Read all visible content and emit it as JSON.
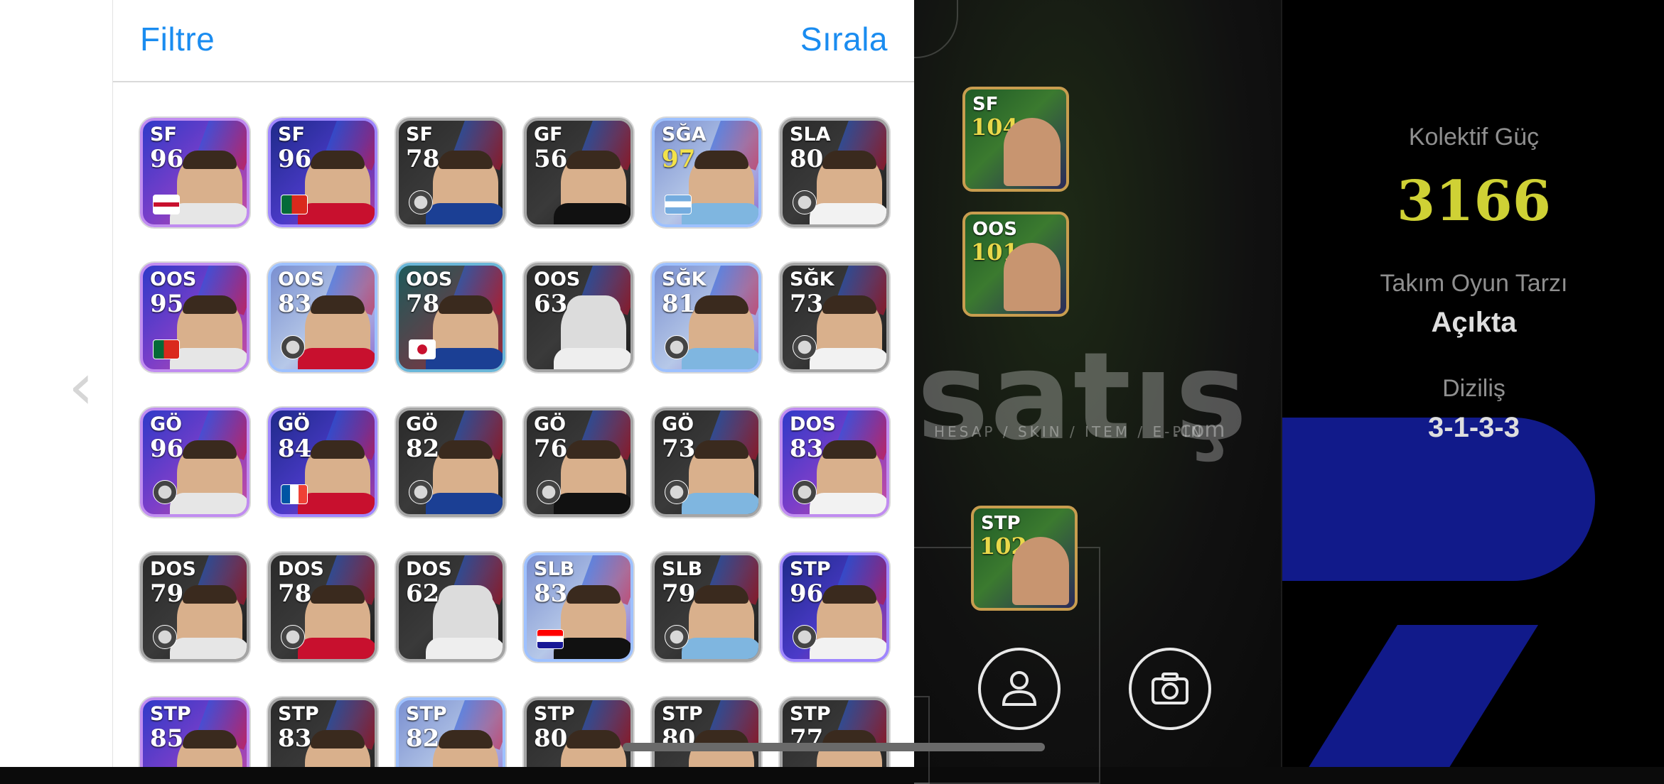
{
  "header": {
    "filter_label": "Filtre",
    "sort_label": "Sırala"
  },
  "back_chevron": "‹",
  "cards": [
    [
      {
        "pos": "SF",
        "ovr": "96",
        "rarity": "epic",
        "flag": "england"
      },
      {
        "pos": "SF",
        "ovr": "96",
        "rarity": "big",
        "flag": "portugal"
      },
      {
        "pos": "SF",
        "ovr": "78",
        "rarity": "std",
        "flag": "club"
      },
      {
        "pos": "GF",
        "ovr": "56",
        "rarity": "std",
        "flag": "none"
      },
      {
        "pos": "SĞA",
        "ovr": "97",
        "rarity": "show",
        "flag": "argentina",
        "gold": true
      },
      {
        "pos": "SLA",
        "ovr": "80",
        "rarity": "std",
        "flag": "club"
      }
    ],
    [
      {
        "pos": "OOS",
        "ovr": "95",
        "rarity": "epic",
        "flag": "portugal"
      },
      {
        "pos": "OOS",
        "ovr": "83",
        "rarity": "show",
        "flag": "club"
      },
      {
        "pos": "OOS",
        "ovr": "78",
        "rarity": "hl",
        "flag": "korea"
      },
      {
        "pos": "OOS",
        "ovr": "63",
        "rarity": "std",
        "flag": "none",
        "blank": true
      },
      {
        "pos": "SĞK",
        "ovr": "81",
        "rarity": "show",
        "flag": "club"
      },
      {
        "pos": "SĞK",
        "ovr": "73",
        "rarity": "std",
        "flag": "club"
      }
    ],
    [
      {
        "pos": "GÖ",
        "ovr": "96",
        "rarity": "epic",
        "flag": "club"
      },
      {
        "pos": "GÖ",
        "ovr": "84",
        "rarity": "big",
        "flag": "france"
      },
      {
        "pos": "GÖ",
        "ovr": "82",
        "rarity": "std",
        "flag": "club"
      },
      {
        "pos": "GÖ",
        "ovr": "76",
        "rarity": "std",
        "flag": "club"
      },
      {
        "pos": "GÖ",
        "ovr": "73",
        "rarity": "std",
        "flag": "club"
      },
      {
        "pos": "DOS",
        "ovr": "83",
        "rarity": "epic",
        "flag": "club"
      }
    ],
    [
      {
        "pos": "DOS",
        "ovr": "79",
        "rarity": "std",
        "flag": "club"
      },
      {
        "pos": "DOS",
        "ovr": "78",
        "rarity": "std",
        "flag": "club"
      },
      {
        "pos": "DOS",
        "ovr": "62",
        "rarity": "std",
        "flag": "none",
        "blank": true
      },
      {
        "pos": "SLB",
        "ovr": "83",
        "rarity": "show",
        "flag": "croatia"
      },
      {
        "pos": "SLB",
        "ovr": "79",
        "rarity": "std",
        "flag": "club"
      },
      {
        "pos": "STP",
        "ovr": "96",
        "rarity": "big",
        "flag": "club"
      }
    ],
    [
      {
        "pos": "STP",
        "ovr": "85",
        "rarity": "epic",
        "flag": "club"
      },
      {
        "pos": "STP",
        "ovr": "83",
        "rarity": "std",
        "flag": "club"
      },
      {
        "pos": "STP",
        "ovr": "82",
        "rarity": "show",
        "flag": "club"
      },
      {
        "pos": "STP",
        "ovr": "80",
        "rarity": "std",
        "flag": "club"
      },
      {
        "pos": "STP",
        "ovr": "80",
        "rarity": "std",
        "flag": "club"
      },
      {
        "pos": "STP",
        "ovr": "77",
        "rarity": "std",
        "flag": "club"
      }
    ]
  ],
  "field_players": [
    {
      "pos": "SF",
      "ovr": "104"
    },
    {
      "pos": "OOS",
      "ovr": "101"
    },
    {
      "pos": "STP",
      "ovr": "102"
    }
  ],
  "watermark": {
    "main": "satış",
    "sub": "HESAP / SKIN / ITEM / E-PIN",
    "com": ".com"
  },
  "stats": {
    "power_label": "Kolektif Güç",
    "power_value": "3166",
    "style_label": "Takım Oyun Tarzı",
    "style_value": "Açıkta",
    "formation_label": "Diziliş",
    "formation_value": "3-1-3-3"
  },
  "icons": [
    "chevron-left-icon",
    "profile-icon",
    "camera-icon"
  ],
  "colors": {
    "accent": "#1a8cf0",
    "power": "#cfd135",
    "frame_gold": "#c89d4f"
  }
}
